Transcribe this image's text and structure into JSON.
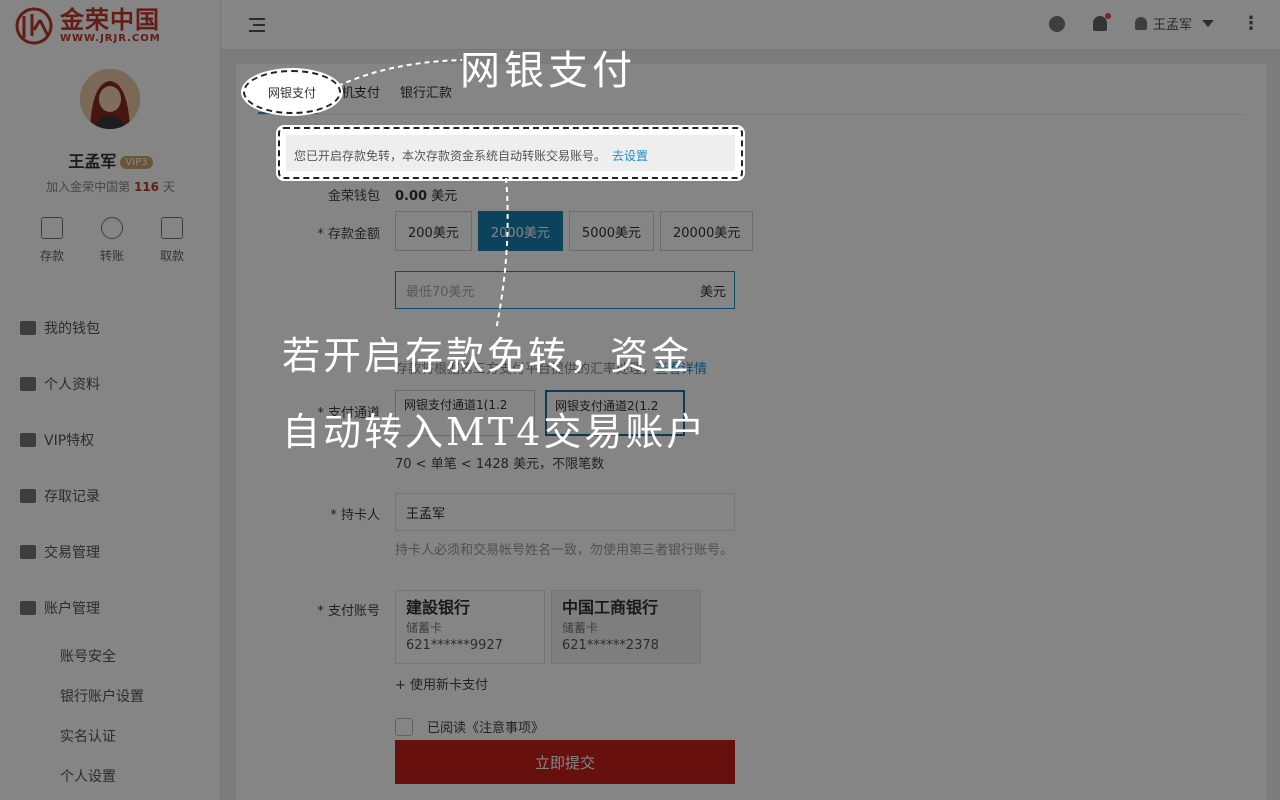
{
  "brand": {
    "name_cn": "金荣中国",
    "url": "WWW.JRJR.COM"
  },
  "profile": {
    "name": "王孟军",
    "vip": "VIP3",
    "joined_prefix": "加入金荣中国第",
    "joined_days": "116",
    "joined_suffix": "天"
  },
  "quick_actions": [
    "存款",
    "转账",
    "取款"
  ],
  "nav": {
    "items": [
      "我的钱包",
      "个人资料",
      "VIP特权",
      "存取记录",
      "交易管理",
      "账户管理"
    ],
    "sub_items": [
      "账号安全",
      "银行账户设置",
      "实名认证",
      "个人设置"
    ]
  },
  "topbar": {
    "user": "王孟军"
  },
  "tabs": [
    "网银支付",
    "手机支付",
    "银行汇款"
  ],
  "notice": {
    "text": "您已开启存款免转，本次存款资金系统自动转账交易账号。",
    "link": "去设置"
  },
  "form": {
    "wallet_label": "金荣钱包",
    "wallet_value": "0.00",
    "wallet_unit": "美元",
    "amount_label": "* 存款金额",
    "amount_options": [
      "200美元",
      "2000美元",
      "5000美元",
      "20000美元"
    ],
    "amount_selected_index": 1,
    "amount_placeholder": "最低70美元",
    "amount_unit": "美元",
    "hint_text": "存款将根据第三方支付平台提供的汇率处理，",
    "hint_link": "查看详情",
    "channel_label": "* 支付通道",
    "channels": [
      "网银支付通道1(1.2",
      "网银支付通道2(1.2"
    ],
    "channel_selected_index": 1,
    "limit_text": "70 < 单笔 < 1428 美元，不限笔数",
    "holder_label": "* 持卡人",
    "holder_value": "王孟军",
    "holder_hint": "持卡人必须和交易帐号姓名一致，勿使用第三者银行账号。",
    "account_label": "* 支付账号",
    "cards": [
      {
        "bank": "建設银行",
        "type": "储蓄卡",
        "number": "621******9927"
      },
      {
        "bank": "中国工商银行",
        "type": "储蓄卡",
        "number": "621******2378"
      }
    ],
    "new_card": "+ 使用新卡支付",
    "agree_text": "已阅读《注意事项》",
    "submit": "立即提交"
  },
  "callouts": {
    "title": "网银支付",
    "body_line1": "若开启存款免转，资金",
    "body_line2": "自动转入MT4交易账户"
  },
  "colors": {
    "brand_red": "#c0392b",
    "accent_blue": "#1a8fd0",
    "submit_red": "#c8201a"
  }
}
